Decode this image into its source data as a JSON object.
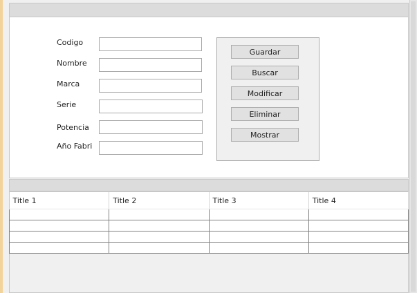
{
  "form": {
    "labels": {
      "codigo": "Codigo",
      "nombre": "Nombre",
      "marca": "Marca",
      "serie": "Serie",
      "potencia": "Potencia",
      "anio": "Año Fabri"
    },
    "values": {
      "codigo": "",
      "nombre": "",
      "marca": "",
      "serie": "",
      "potencia": "",
      "anio": ""
    }
  },
  "buttons": {
    "guardar": "Guardar",
    "buscar": "Buscar",
    "modificar": "Modificar",
    "eliminar": "Eliminar",
    "mostrar": "Mostrar"
  },
  "table": {
    "columns": [
      "Title 1",
      "Title 2",
      "Title 3",
      "Title 4"
    ],
    "rows": [
      [
        "",
        "",
        "",
        ""
      ],
      [
        "",
        "",
        "",
        ""
      ],
      [
        "",
        "",
        "",
        ""
      ],
      [
        "",
        "",
        "",
        ""
      ]
    ]
  },
  "colors": {
    "frame": "#f4d9a4",
    "panel": "#ffffff",
    "button_face": "#e1e1e1"
  }
}
